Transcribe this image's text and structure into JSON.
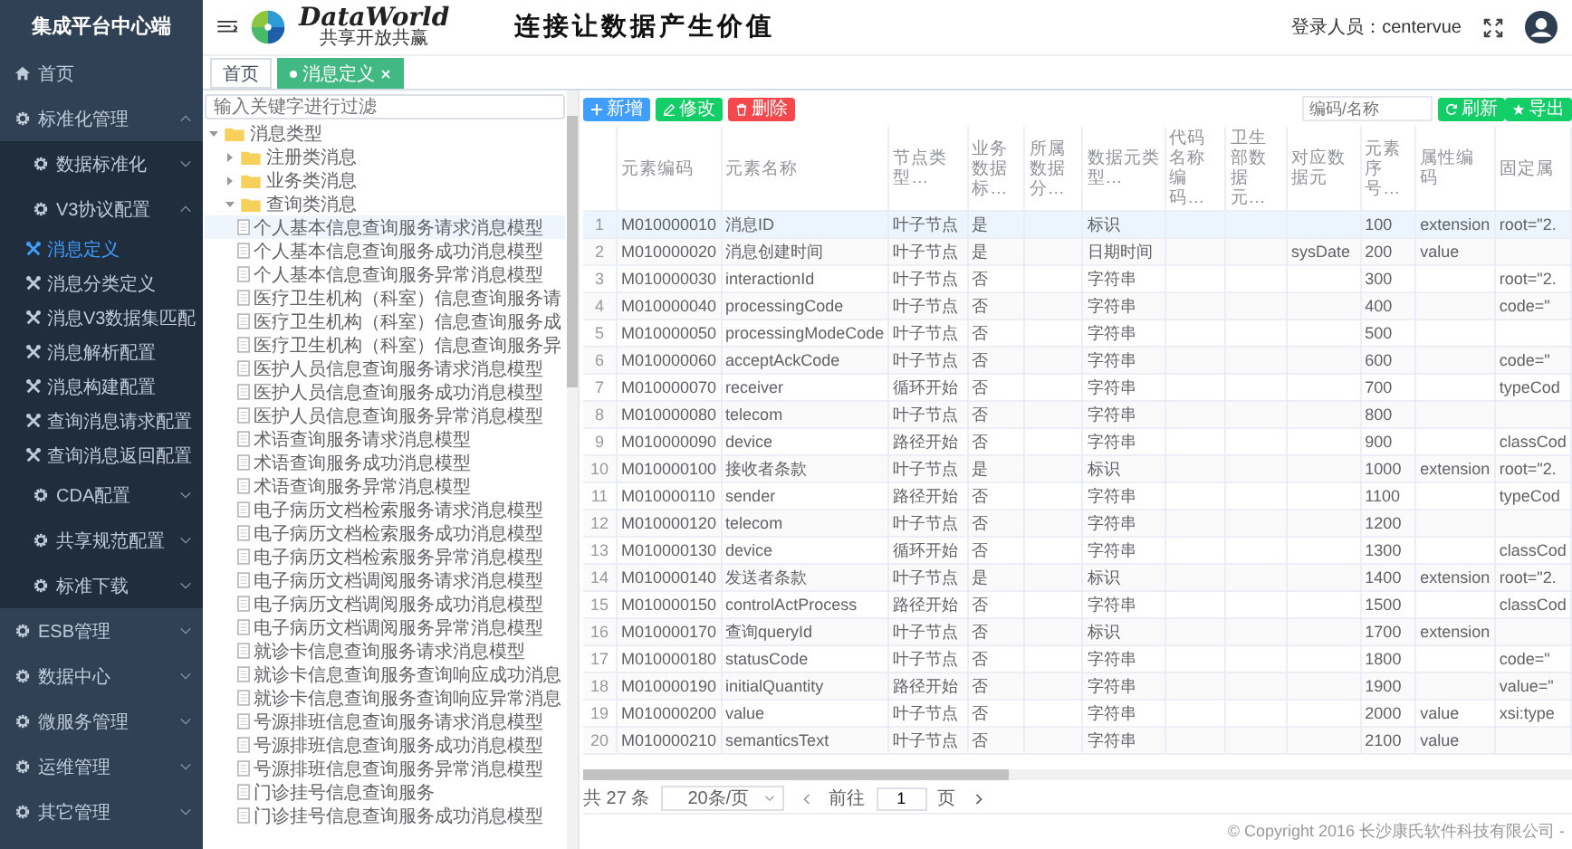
{
  "sidebar": {
    "title": "集成平台中心端",
    "items": [
      {
        "label": "首页",
        "kind": "home",
        "selected": false
      },
      {
        "label": "标准化管理",
        "kind": "gear",
        "selected": false,
        "expanded": true,
        "children": [
          {
            "label": "数据标准化",
            "kind": "gear",
            "selected": false,
            "expanded": false
          },
          {
            "label": "V3协议配置",
            "kind": "gear",
            "selected": false,
            "expanded": true,
            "children": [
              {
                "label": "消息定义",
                "kind": "tool",
                "selected": true
              },
              {
                "label": "消息分类定义",
                "kind": "tool",
                "selected": false
              },
              {
                "label": "消息V3数据集匹配",
                "kind": "tool",
                "selected": false
              },
              {
                "label": "消息解析配置",
                "kind": "tool",
                "selected": false
              },
              {
                "label": "消息构建配置",
                "kind": "tool",
                "selected": false
              },
              {
                "label": "查询消息请求配置",
                "kind": "tool",
                "selected": false
              },
              {
                "label": "查询消息返回配置",
                "kind": "tool",
                "selected": false
              }
            ]
          },
          {
            "label": "CDA配置",
            "kind": "gear",
            "selected": false,
            "expanded": false
          },
          {
            "label": "共享规范配置",
            "kind": "gear",
            "selected": false,
            "expanded": false
          },
          {
            "label": "标准下载",
            "kind": "gear",
            "selected": false,
            "expanded": false
          }
        ]
      },
      {
        "label": "ESB管理",
        "kind": "gear",
        "selected": false,
        "expanded": false
      },
      {
        "label": "数据中心",
        "kind": "gear",
        "selected": false,
        "expanded": false
      },
      {
        "label": "微服务管理",
        "kind": "gear",
        "selected": false,
        "expanded": false
      },
      {
        "label": "运维管理",
        "kind": "gear",
        "selected": false,
        "expanded": false
      },
      {
        "label": "其它管理",
        "kind": "gear",
        "selected": false,
        "expanded": false
      }
    ]
  },
  "header": {
    "logo_text": "DataWorld",
    "logo_subtitle": "共享开放共赢",
    "slogan": "连接让数据产生价值",
    "user": "登录人员：centervue"
  },
  "tabs": [
    {
      "label": "首页",
      "selected": false,
      "closable": false
    },
    {
      "label": "消息定义",
      "selected": true,
      "closable": true
    }
  ],
  "tree": {
    "filter_placeholder": "输入关键字进行过滤",
    "nodes": [
      {
        "label": "消息类型",
        "kind": "folder",
        "expanded": true,
        "children": [
          {
            "label": "注册类消息",
            "kind": "folder",
            "expanded": false
          },
          {
            "label": "业务类消息",
            "kind": "folder",
            "expanded": false
          },
          {
            "label": "查询类消息",
            "kind": "folder",
            "expanded": true,
            "children": [
              {
                "label": "个人基本信息查询服务请求消息模型",
                "kind": "file",
                "selected": true
              },
              {
                "label": "个人基本信息查询服务成功消息模型",
                "kind": "file",
                "selected": false
              },
              {
                "label": "个人基本信息查询服务异常消息模型",
                "kind": "file",
                "selected": false
              },
              {
                "label": "医疗卫生机构（科室）信息查询服务请",
                "kind": "file",
                "selected": false
              },
              {
                "label": "医疗卫生机构（科室）信息查询服务成",
                "kind": "file",
                "selected": false
              },
              {
                "label": "医疗卫生机构（科室）信息查询服务异",
                "kind": "file",
                "selected": false
              },
              {
                "label": "医护人员信息查询服务请求消息模型",
                "kind": "file",
                "selected": false
              },
              {
                "label": "医护人员信息查询服务成功消息模型",
                "kind": "file",
                "selected": false
              },
              {
                "label": "医护人员信息查询服务异常消息模型",
                "kind": "file",
                "selected": false
              },
              {
                "label": "术语查询服务请求消息模型",
                "kind": "file",
                "selected": false
              },
              {
                "label": "术语查询服务成功消息模型",
                "kind": "file",
                "selected": false
              },
              {
                "label": "术语查询服务异常消息模型",
                "kind": "file",
                "selected": false
              },
              {
                "label": "电子病历文档检索服务请求消息模型",
                "kind": "file",
                "selected": false
              },
              {
                "label": "电子病历文档检索服务成功消息模型",
                "kind": "file",
                "selected": false
              },
              {
                "label": "电子病历文档检索服务异常消息模型",
                "kind": "file",
                "selected": false
              },
              {
                "label": "电子病历文档调阅服务请求消息模型",
                "kind": "file",
                "selected": false
              },
              {
                "label": "电子病历文档调阅服务成功消息模型",
                "kind": "file",
                "selected": false
              },
              {
                "label": "电子病历文档调阅服务异常消息模型",
                "kind": "file",
                "selected": false
              },
              {
                "label": "就诊卡信息查询服务请求消息模型",
                "kind": "file",
                "selected": false
              },
              {
                "label": "就诊卡信息查询服务查询响应成功消息",
                "kind": "file",
                "selected": false
              },
              {
                "label": "就诊卡信息查询服务查询响应异常消息",
                "kind": "file",
                "selected": false
              },
              {
                "label": "号源排班信息查询服务请求消息模型",
                "kind": "file",
                "selected": false
              },
              {
                "label": "号源排班信息查询服务成功消息模型",
                "kind": "file",
                "selected": false
              },
              {
                "label": "号源排班信息查询服务异常消息模型",
                "kind": "file",
                "selected": false
              },
              {
                "label": "门诊挂号信息查询服务",
                "kind": "file",
                "selected": false
              },
              {
                "label": "门诊挂号信息查询服务成功消息模型",
                "kind": "file",
                "selected": false
              }
            ]
          }
        ]
      }
    ]
  },
  "toolbar": {
    "buttons": [
      {
        "label": "新增",
        "kind": "add"
      },
      {
        "label": "修改",
        "kind": "edit"
      },
      {
        "label": "删除",
        "kind": "delete"
      }
    ],
    "search_placeholder": "编码/名称",
    "right_buttons": [
      {
        "label": "刷新",
        "kind": "refresh"
      },
      {
        "label": "导出",
        "kind": "export"
      }
    ]
  },
  "table": {
    "columns": [
      "元素编码",
      "元素名称",
      "节点类型…",
      "业务数据标…",
      "所属数据分…",
      "数据元类型…",
      "代码名称编码…",
      "卫生部数据元…",
      "对应数据元",
      "元素序号…",
      "属性编码",
      "固定属"
    ],
    "rows": [
      {
        "index": "1",
        "selected": true,
        "cells": [
          "M010000010",
          "消息ID",
          "叶子节点",
          "是",
          null,
          "标识",
          null,
          null,
          null,
          "100",
          "extension",
          "root=\"2."
        ]
      },
      {
        "index": "2",
        "selected": false,
        "cells": [
          "M010000020",
          "消息创建时间",
          "叶子节点",
          "是",
          null,
          "日期时间",
          null,
          null,
          "sysDate",
          "200",
          "value",
          null
        ]
      },
      {
        "index": "3",
        "selected": false,
        "cells": [
          "M010000030",
          "interactionId",
          "叶子节点",
          "否",
          null,
          "字符串",
          null,
          null,
          null,
          "300",
          null,
          "root=\"2."
        ]
      },
      {
        "index": "4",
        "selected": false,
        "cells": [
          "M010000040",
          "processingCode",
          "叶子节点",
          "否",
          null,
          "字符串",
          null,
          null,
          null,
          "400",
          null,
          "code=\""
        ]
      },
      {
        "index": "5",
        "selected": false,
        "cells": [
          "M010000050",
          "processingModeCode",
          "叶子节点",
          "否",
          null,
          "字符串",
          null,
          null,
          null,
          "500",
          null,
          null
        ]
      },
      {
        "index": "6",
        "selected": false,
        "cells": [
          "M010000060",
          "acceptAckCode",
          "叶子节点",
          "否",
          null,
          "字符串",
          null,
          null,
          null,
          "600",
          null,
          "code=\""
        ]
      },
      {
        "index": "7",
        "selected": false,
        "cells": [
          "M010000070",
          "receiver",
          "循环开始",
          "否",
          null,
          "字符串",
          null,
          null,
          null,
          "700",
          null,
          "typeCod"
        ]
      },
      {
        "index": "8",
        "selected": false,
        "cells": [
          "M010000080",
          "telecom",
          "叶子节点",
          "否",
          null,
          "字符串",
          null,
          null,
          null,
          "800",
          null,
          null
        ]
      },
      {
        "index": "9",
        "selected": false,
        "cells": [
          "M010000090",
          "device",
          "路径开始",
          "否",
          null,
          "字符串",
          null,
          null,
          null,
          "900",
          null,
          "classCod"
        ]
      },
      {
        "index": "10",
        "selected": false,
        "cells": [
          "M010000100",
          "接收者条款",
          "叶子节点",
          "是",
          null,
          "标识",
          null,
          null,
          null,
          "1000",
          "extension",
          "root=\"2."
        ]
      },
      {
        "index": "11",
        "selected": false,
        "cells": [
          "M010000110",
          "sender",
          "路径开始",
          "否",
          null,
          "字符串",
          null,
          null,
          null,
          "1100",
          null,
          "typeCod"
        ]
      },
      {
        "index": "12",
        "selected": false,
        "cells": [
          "M010000120",
          "telecom",
          "叶子节点",
          "否",
          null,
          "字符串",
          null,
          null,
          null,
          "1200",
          null,
          null
        ]
      },
      {
        "index": "13",
        "selected": false,
        "cells": [
          "M010000130",
          "device",
          "循环开始",
          "否",
          null,
          "字符串",
          null,
          null,
          null,
          "1300",
          null,
          "classCod"
        ]
      },
      {
        "index": "14",
        "selected": false,
        "cells": [
          "M010000140",
          "发送者条款",
          "叶子节点",
          "是",
          null,
          "标识",
          null,
          null,
          null,
          "1400",
          "extension",
          "root=\"2."
        ]
      },
      {
        "index": "15",
        "selected": false,
        "cells": [
          "M010000150",
          "controlActProcess",
          "路径开始",
          "否",
          null,
          "字符串",
          null,
          null,
          null,
          "1500",
          null,
          "classCod"
        ]
      },
      {
        "index": "16",
        "selected": false,
        "cells": [
          "M010000170",
          "查询queryId",
          "叶子节点",
          "否",
          null,
          "标识",
          null,
          null,
          null,
          "1700",
          "extension",
          null
        ]
      },
      {
        "index": "17",
        "selected": false,
        "cells": [
          "M010000180",
          "statusCode",
          "叶子节点",
          "否",
          null,
          "字符串",
          null,
          null,
          null,
          "1800",
          null,
          "code=\""
        ]
      },
      {
        "index": "18",
        "selected": false,
        "cells": [
          "M010000190",
          "initialQuantity",
          "路径开始",
          "否",
          null,
          "字符串",
          null,
          null,
          null,
          "1900",
          null,
          "value=\""
        ]
      },
      {
        "index": "19",
        "selected": false,
        "cells": [
          "M010000200",
          "value",
          "叶子节点",
          "否",
          null,
          "字符串",
          null,
          null,
          null,
          "2000",
          "value",
          "xsi:type"
        ]
      },
      {
        "index": "20",
        "selected": false,
        "cells": [
          "M010000210",
          "semanticsText",
          "叶子节点",
          "否",
          null,
          "字符串",
          null,
          null,
          null,
          "2100",
          "value",
          null
        ]
      }
    ]
  },
  "pagination": {
    "total": "共 27 条",
    "page_size": "20条/页",
    "goto_label": "前往",
    "page": "1",
    "page_suffix": "页"
  },
  "footer": {
    "copyright": "© Copyright 2016 长沙康氏软件科技有限公司 -"
  }
}
